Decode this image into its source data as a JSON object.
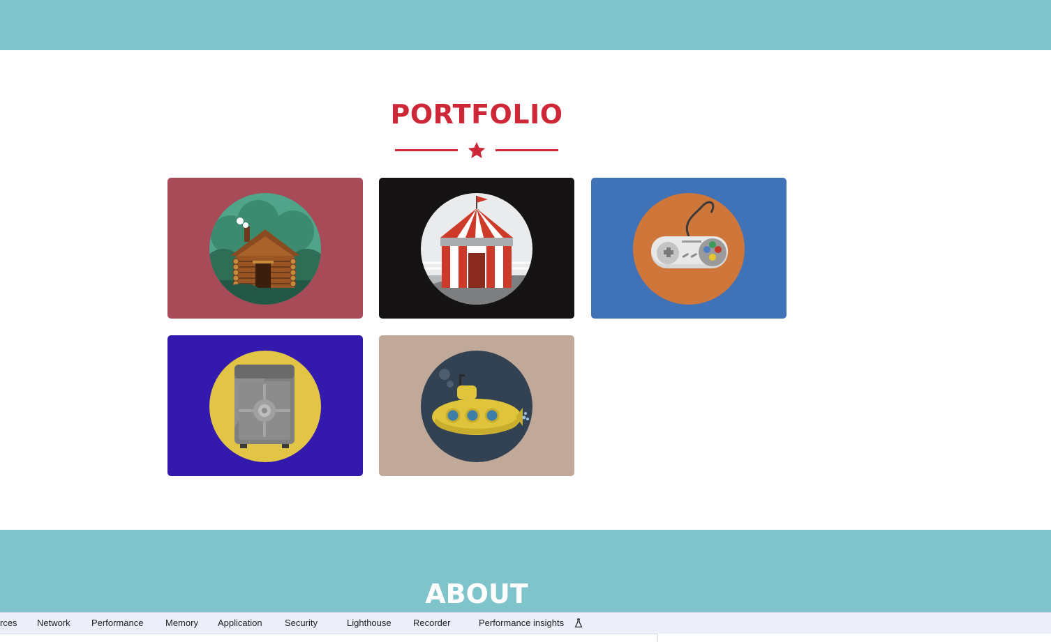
{
  "portfolio": {
    "title": "PORTFOLIO",
    "accent_color": "#cd2738",
    "items": [
      {
        "name": "log-cabin",
        "icon": "cabin-icon",
        "bg": "#a84b58"
      },
      {
        "name": "circus-tent",
        "icon": "circus-tent-icon",
        "bg": "#151314"
      },
      {
        "name": "game-controller",
        "icon": "game-controller-icon",
        "bg": "#4072b8"
      },
      {
        "name": "safe",
        "icon": "safe-icon",
        "bg": "#3419ad"
      },
      {
        "name": "submarine",
        "icon": "submarine-icon",
        "bg": "#c0a998"
      }
    ]
  },
  "about": {
    "title": "ABOUT"
  },
  "devtools": {
    "tabs": [
      "rces",
      "Network",
      "Performance",
      "Memory",
      "Application",
      "Security",
      "Lighthouse",
      "Recorder",
      "Performance insights"
    ],
    "flask_icon": "flask-icon"
  },
  "colors": {
    "band": "#80c4cb"
  }
}
